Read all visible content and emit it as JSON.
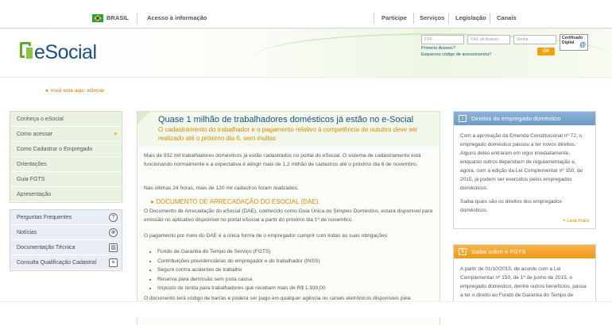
{
  "govbar": {
    "brasil": "BRASIL",
    "acesso": "Acesso à informação",
    "links": [
      "Participe",
      "Serviços",
      "Legislação",
      "Canais"
    ]
  },
  "header": {
    "logo_text": "eSocial",
    "cpf_placeholder": "CPF",
    "codigo_placeholder": "Cód. de Acesso",
    "senha_placeholder": "Senha",
    "cert_label": "Certificado Digital",
    "primeiro_acesso": "Primeiro Acesso?",
    "esqueceu": "Esqueceu código de acesso/senha?",
    "ok_label": "OK"
  },
  "breadcrumb": "Você está aqui: eSocial",
  "menu_main": [
    {
      "label": "Conheça o eSocial"
    },
    {
      "label": "Como acessar"
    },
    {
      "label": "Como Cadastrar o Empregado"
    },
    {
      "label": "Orientações"
    },
    {
      "label": "Guia FGTS"
    },
    {
      "label": "Apresentação"
    }
  ],
  "menu_secondary": [
    {
      "label": "Perguntas Frequentes",
      "icon": "question-icon"
    },
    {
      "label": "Notícias",
      "icon": "globe-icon"
    },
    {
      "label": "Documentação Técnica",
      "icon": "book-icon"
    },
    {
      "label": "Consulta Qualificação Cadastral",
      "icon": "document-icon"
    }
  ],
  "article": {
    "title": "Quase 1 milhão de trabalhadores domésticos já estão no e-Social",
    "subtitle": "O cadastramento do trabalhador e o pagamento relativo à competência de outubro deve ser realizado até o próximo dia 6, sem multas",
    "p1": "Mais de 932 mil trabalhadores domésticos já estão cadastrados no portal do eSocial. O sistema de cadastramento está funcionando normalmente e a expectativa é atingir mais de 1,2 milhão de cadastros até o próximo dia 6 de novembro.",
    "p2": "Nas últimas 24 horas, mais de 120 mil cadastros foram realizados.",
    "dae_title": "DOCUMENTO DE ARRECADAÇÃO DO ESOCIAL (DAE):",
    "p3": "O Documento de Arrecadação do eSocial (DAE), conhecido como Guia Única do Simples Doméstico, estará disponível para emissão no aplicativo disponível no portal eSocial a partir do próximo dia 1º de novembro.",
    "p4": "O pagamento por meio do DAE é a única forma de o empregador cumprir com todas as suas obrigações:",
    "bullets": [
      "Fundo de Garantia do Tempo de Serviço (FGTS)",
      "Contribuições previdenciárias do empregador e do trabalhador (INSS)",
      "Seguro contra acidentes de trabalho",
      "Reserva para demissão sem justa causa",
      "Imposto de renda para trabalhadores que recebam mais de R$ 1.930,00"
    ],
    "p5": "O documento terá código de barras e poderá ser pago em qualquer agência ou canais eletrônicos disponíveis pela"
  },
  "box1": {
    "title": "Direitos do empregado doméstico",
    "p1": "Com a aprovação da Emenda Constitucional nº 72, o empregado doméstico passou a ter novos direitos. Alguns deles entraram em vigor imediatamente, enquanto outros dependiam de regulamentação e, agora, com a edição da Lei Complementar nº 150, de 2015, já podem ser exercidos pelos empregados domésticos.",
    "p2": "Saiba quais são os direitos dos empregados domésticos.",
    "more": "+ Leia mais"
  },
  "box2": {
    "title": "Saiba sobre o FGTS",
    "p1": "A partir de 01/10/2015, de acordo com a Lei Complementar nº 150, de 1º de junho de 2015, o empregado doméstico, dentre outros benefícios, passa a ter o direito ao Fundo de Garantia do Tempo de"
  }
}
